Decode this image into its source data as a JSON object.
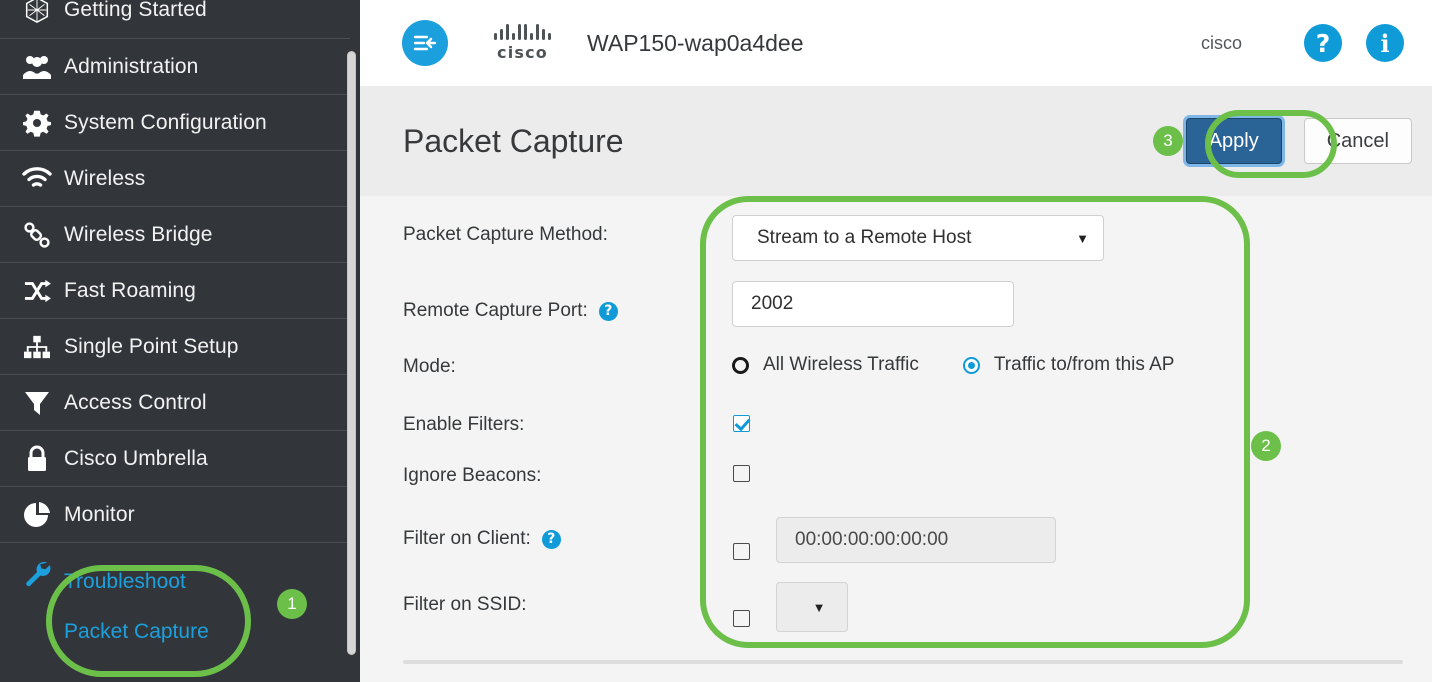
{
  "sidebar": {
    "items": [
      {
        "label": "Getting Started",
        "icon": "getting-started-icon"
      },
      {
        "label": "Administration",
        "icon": "users-icon"
      },
      {
        "label": "System Configuration",
        "icon": "gear-icon"
      },
      {
        "label": "Wireless",
        "icon": "wifi-icon"
      },
      {
        "label": "Wireless Bridge",
        "icon": "link-icon"
      },
      {
        "label": "Fast Roaming",
        "icon": "shuffle-icon"
      },
      {
        "label": "Single Point Setup",
        "icon": "hierarchy-icon"
      },
      {
        "label": "Access Control",
        "icon": "filter-icon"
      },
      {
        "label": "Cisco Umbrella",
        "icon": "lock-icon"
      },
      {
        "label": "Monitor",
        "icon": "pie-chart-icon"
      }
    ],
    "group": {
      "icon": "wrench-icon",
      "links": [
        "Troubleshoot",
        "Packet Capture"
      ]
    }
  },
  "header": {
    "menu_icon": "hamburger-collapse-icon",
    "brand": "cisco",
    "device_name": "WAP150-wap0a4dee",
    "user": "cisco",
    "help_icon": "question-mark-icon",
    "info_icon": "info-icon"
  },
  "title_bar": {
    "title": "Packet Capture",
    "apply_label": "Apply",
    "cancel_label": "Cancel"
  },
  "form": {
    "rows": {
      "method": {
        "label": "Packet Capture Method:",
        "value": "Stream to a Remote Host",
        "caret": "▼"
      },
      "remote_port": {
        "label": "Remote Capture Port:",
        "help": "?",
        "value": "2002"
      },
      "mode": {
        "label": "Mode:",
        "option_all": "All Wireless Traffic",
        "option_ap": "Traffic to/from this AP",
        "selected": "Traffic to/from this AP"
      },
      "enable_filters": {
        "label": "Enable Filters:",
        "checked": true
      },
      "ignore_beacons": {
        "label": "Ignore Beacons:",
        "checked": false
      },
      "filter_client": {
        "label": "Filter on Client:",
        "help": "?",
        "checked": false,
        "value": "00:00:00:00:00:00"
      },
      "filter_ssid": {
        "label": "Filter on SSID:",
        "checked": false,
        "value": "",
        "caret": "▼"
      }
    }
  },
  "annotations": {
    "badge_1": "1",
    "badge_2": "2",
    "badge_3": "3",
    "highlight_color": "#6cc04a"
  }
}
